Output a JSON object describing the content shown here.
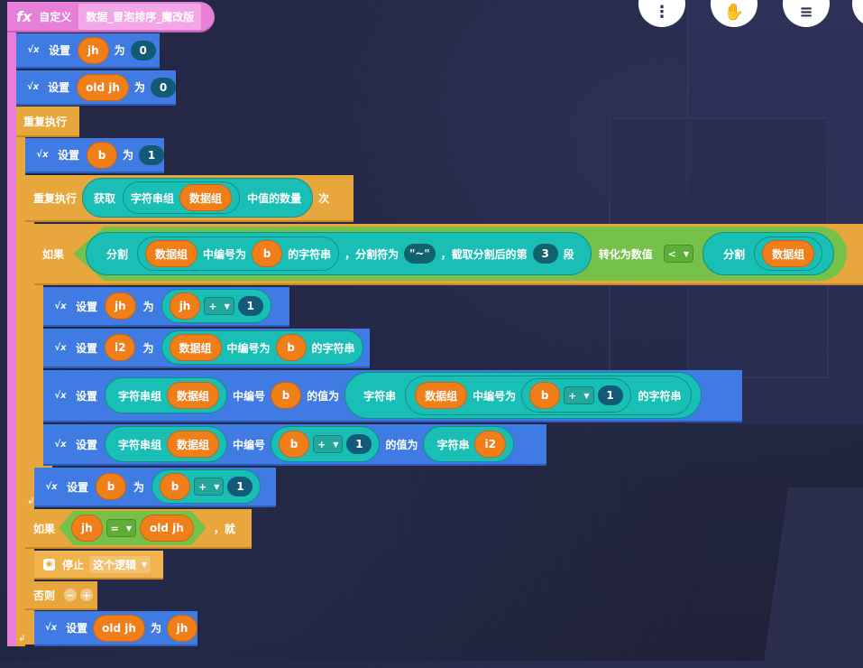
{
  "toolbar": {
    "more_label": "⋮",
    "hand_label": "✋",
    "list_label": "≡"
  },
  "header": {
    "fx_label": "fx",
    "define_label": "自定义",
    "func_name": "数据_冒泡排序_魔改版"
  },
  "kw": {
    "set": "设置",
    "to": "为",
    "repeat": "重复执行",
    "times": "次",
    "if": "如果",
    "then": "，就",
    "else": "否则",
    "stop": "停止",
    "this_logic": "这个逻辑",
    "get": "获取",
    "string_array": "字符串组",
    "count_values": "中值的数量",
    "split": "分割",
    "index_str": "中编号为",
    "of_string": "的字符串",
    "sep_is": "，分割符为",
    "take_nth": "，截取分割后的第",
    "segment": "段",
    "to_number": "转化为数值",
    "index": "中编号",
    "value_is": "的值为",
    "string": "字符串"
  },
  "vars": {
    "jh": "jh",
    "old_jh": "old jh",
    "b": "b",
    "i2": "i2",
    "data_arr": "数据组"
  },
  "vals": {
    "zero": "0",
    "one": "1",
    "three": "3",
    "sep": "\"~\""
  },
  "ops": {
    "plus": "+",
    "lt": "<",
    "eq": "="
  },
  "colors": {
    "event": "#e77fd8",
    "control": "#e8a73c",
    "action": "#3f7be3",
    "logic": "#76c14a",
    "operator": "#19bfb4",
    "variable": "#f07f1a"
  }
}
